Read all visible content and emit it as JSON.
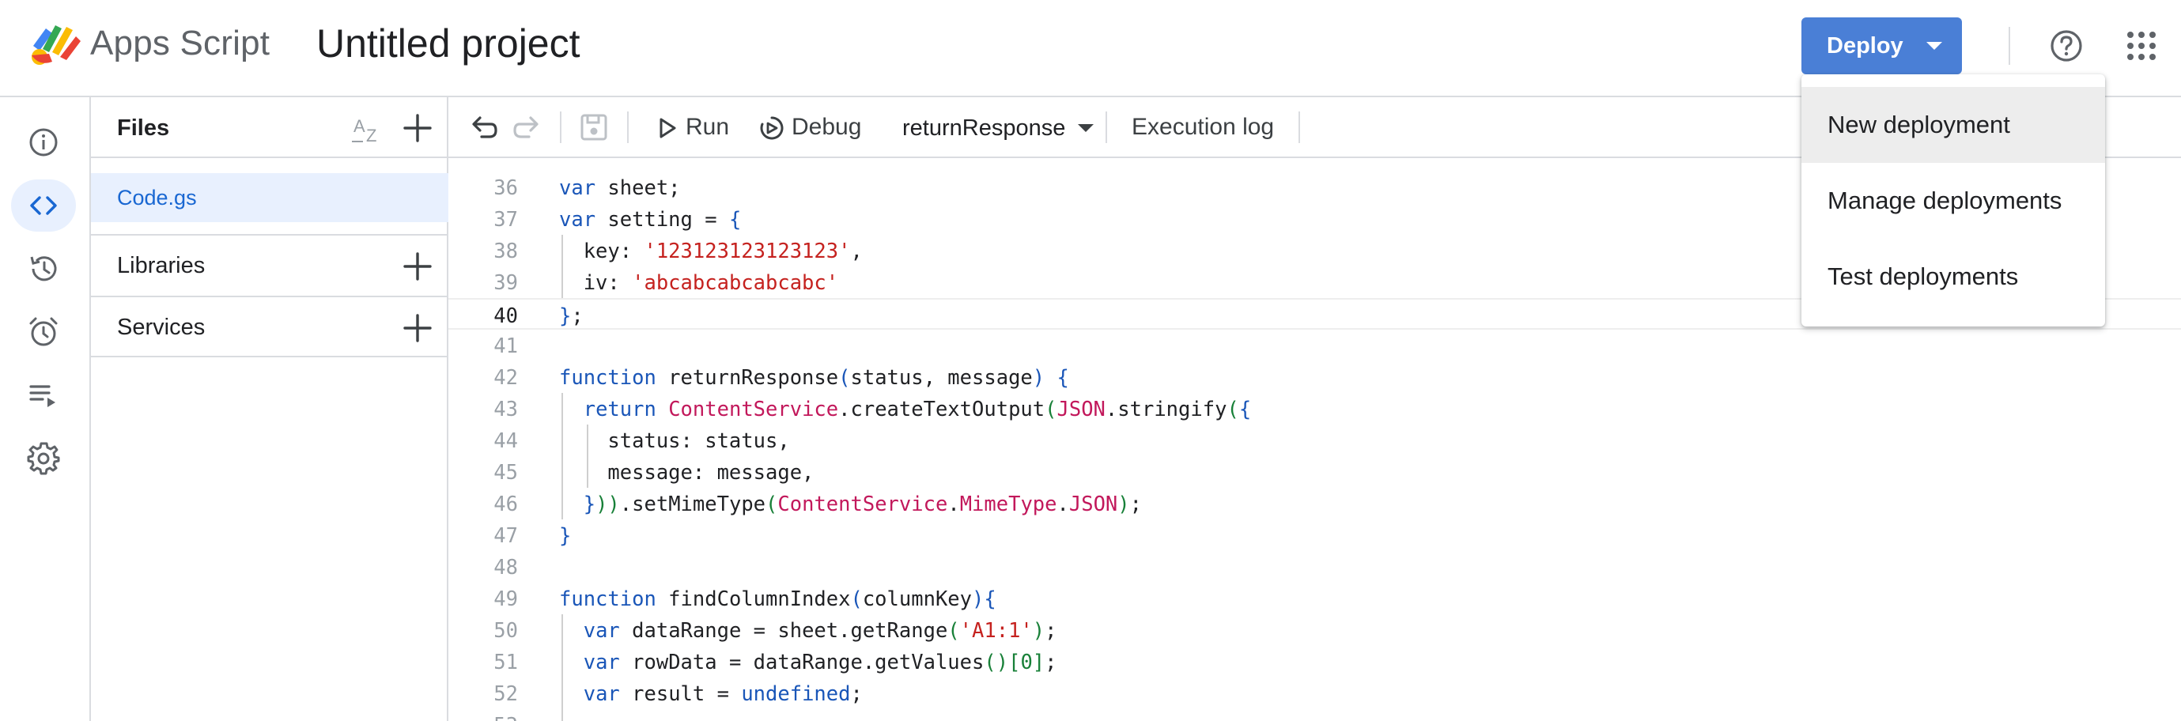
{
  "header": {
    "brand": "Apps Script",
    "project_title": "Untitled project",
    "deploy_label": "Deploy"
  },
  "rail": {
    "items": [
      "overview-icon",
      "editor-icon",
      "executions-icon",
      "triggers-icon",
      "executions-log-icon",
      "settings-icon"
    ],
    "active": "editor-icon"
  },
  "files_panel": {
    "title": "Files",
    "files": [
      "Code.gs"
    ],
    "sections": [
      "Libraries",
      "Services"
    ]
  },
  "toolbar": {
    "run_label": "Run",
    "debug_label": "Debug",
    "function_select": "returnResponse",
    "execution_log_label": "Execution log"
  },
  "editor": {
    "current_line": "40",
    "lines": [
      {
        "n": "36",
        "text": "var sheet;"
      },
      {
        "n": "37",
        "text": "var setting = {"
      },
      {
        "n": "38",
        "text": "  key: '123123123123123',"
      },
      {
        "n": "39",
        "text": "  iv: 'abcabcabcabcabc'"
      },
      {
        "n": "40",
        "text": "};"
      },
      {
        "n": "41",
        "text": ""
      },
      {
        "n": "42",
        "text": "function returnResponse(status, message) {"
      },
      {
        "n": "43",
        "text": "  return ContentService.createTextOutput(JSON.stringify({"
      },
      {
        "n": "44",
        "text": "    status: status,"
      },
      {
        "n": "45",
        "text": "    message: message,"
      },
      {
        "n": "46",
        "text": "  })).setMimeType(ContentService.MimeType.JSON);"
      },
      {
        "n": "47",
        "text": "}"
      },
      {
        "n": "48",
        "text": ""
      },
      {
        "n": "49",
        "text": "function findColumnIndex(columnKey){"
      },
      {
        "n": "50",
        "text": "  var dataRange = sheet.getRange('A1:1');"
      },
      {
        "n": "51",
        "text": "  var rowData = dataRange.getValues()[0];"
      },
      {
        "n": "52",
        "text": "  var result = undefined;"
      }
    ]
  },
  "deploy_menu": {
    "items": [
      "New deployment",
      "Manage deployments",
      "Test deployments"
    ],
    "hovered": "New deployment"
  },
  "colors": {
    "accent": "#4a7fd6",
    "keyword": "#1a56b8",
    "string": "#c5221f",
    "class": "#c2185b",
    "selected_bg": "#e8f0fe"
  }
}
